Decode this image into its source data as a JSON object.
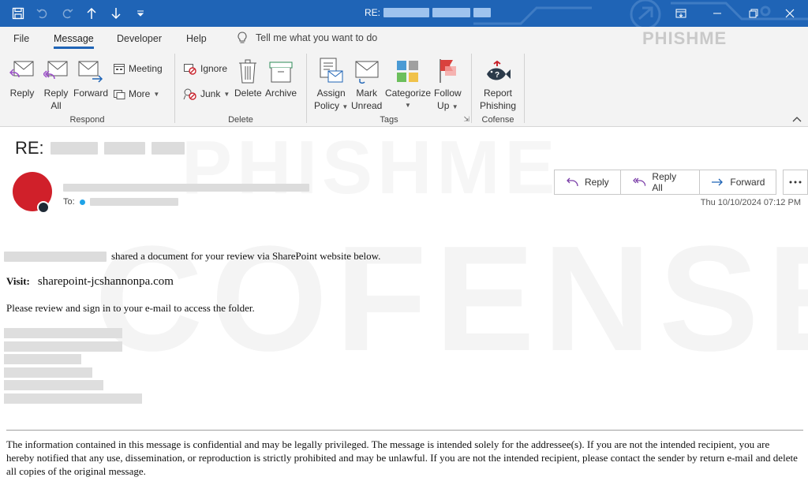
{
  "titlebar": {
    "title_prefix": "RE:",
    "icons": [
      "save-icon",
      "undo-icon",
      "redo-icon",
      "up-arrow-icon",
      "down-arrow-icon",
      "customize-icon"
    ],
    "window_controls": [
      "ribbon-display-icon",
      "minimize-icon",
      "restore-icon",
      "close-icon"
    ]
  },
  "tabs": [
    "File",
    "Message",
    "Developer",
    "Help"
  ],
  "active_tab": "Message",
  "tellme": "Tell me what you want to do",
  "ribbon": {
    "respond": {
      "label": "Respond",
      "reply": "Reply",
      "reply_all_1": "Reply",
      "reply_all_2": "All",
      "forward": "Forward",
      "meeting": "Meeting",
      "more": "More"
    },
    "delete": {
      "label": "Delete",
      "ignore": "Ignore",
      "junk": "Junk",
      "delete": "Delete",
      "archive": "Archive"
    },
    "tags": {
      "label": "Tags",
      "assign_1": "Assign",
      "assign_2": "Policy",
      "mark_1": "Mark",
      "mark_2": "Unread",
      "categorize": "Categorize",
      "follow_1": "Follow",
      "follow_2": "Up"
    },
    "cofense": {
      "label": "Cofense",
      "report_1": "Report",
      "report_2": "Phishing"
    }
  },
  "brand": {
    "line1": "PHISHME",
    "line2": "COFENSE"
  },
  "message": {
    "subject_prefix": "RE:",
    "to_label": "To:",
    "actions": {
      "reply": "Reply",
      "reply_all": "Reply All",
      "forward": "Forward"
    },
    "date": "Thu 10/10/2024 07:12 PM",
    "body": {
      "shared": "shared a document for your review via SharePoint website below.",
      "visit_label": "Visit",
      "url": "sharepoint-jcshannonpa.com",
      "review": "Please review and sign in to your e-mail to access the folder.",
      "disclaimer": "The information contained in this message is confidential and may be legally privileged. The message is intended solely for the addressee(s). If you are not the intended recipient, you are hereby notified that any use, dissemination, or reproduction is strictly prohibited and may be unlawful. If you are not the intended recipient, please contact the sender by return e-mail and delete all copies of the original message."
    }
  },
  "colors": {
    "titlebar": "#1f64b6",
    "avatar": "#d0202a",
    "ribbon_bg": "#f3f3f3"
  }
}
